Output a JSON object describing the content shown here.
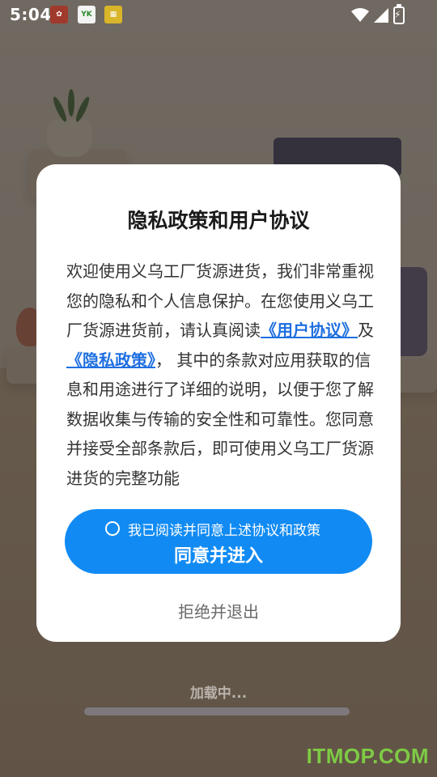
{
  "status_bar": {
    "time": "5:04",
    "notification_icons": [
      "app-icon-red",
      "app-icon-yk",
      "app-icon-green"
    ],
    "notif_yk_label": "YK"
  },
  "dialog": {
    "title": "隐私政策和用户协议",
    "body_part1": "欢迎使用义乌工厂货源进货，我们非常重视您的隐私和个人信息保护。在您使用义乌工厂货源进货前，请认真阅读",
    "link_user_agreement": "《用户协议》",
    "body_and": "及",
    "link_privacy_policy": "《隐私政策》",
    "body_part2": "， 其中的条款对应用获取的信息和用途进行了详细的说明，以便于您了解数据收集与传输的安全性和可靠性。您同意并接受全部条款后，即可使用义乌工厂货源进货的完整功能",
    "checkbox_label": "我已阅读并同意上述协议和政策",
    "agree_button": "同意并进入",
    "reject_button": "拒绝并退出"
  },
  "loading": {
    "text": "加载中..."
  },
  "watermark": "ITMOP.COM",
  "colors": {
    "accent": "#118bf3",
    "link": "#1e6fe0",
    "watermark": "#7ecb44"
  }
}
